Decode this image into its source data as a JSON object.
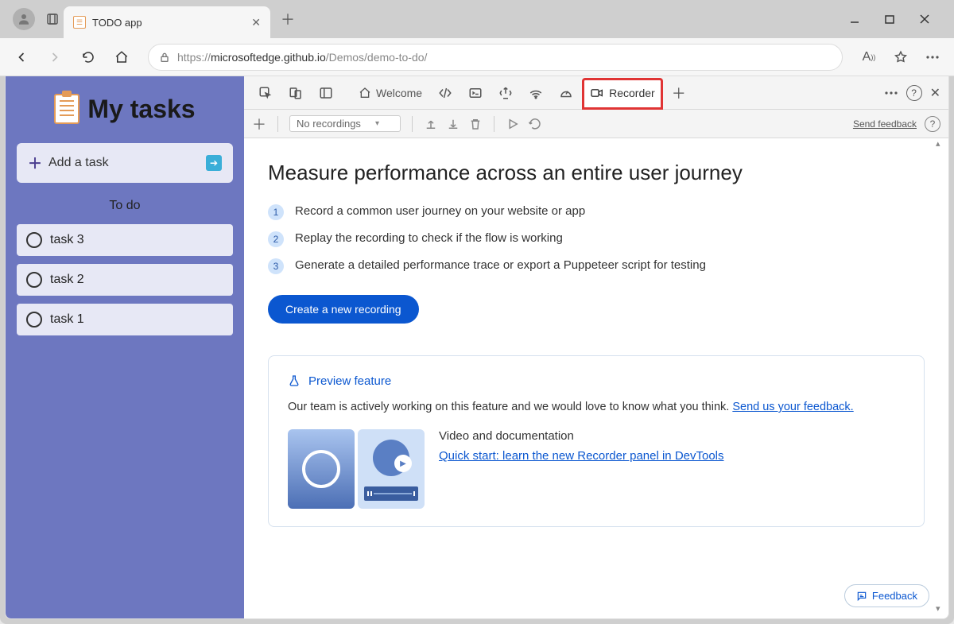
{
  "browser": {
    "tab_title": "TODO app",
    "url_host": "microsoftedge.github.io",
    "url_prefix": "https://",
    "url_path": "/Demos/demo-to-do/"
  },
  "app": {
    "title": "My tasks",
    "add_task_label": "Add a task",
    "section_label": "To do",
    "tasks": [
      "task 3",
      "task 2",
      "task 1"
    ]
  },
  "devtools": {
    "tabs": {
      "welcome": "Welcome",
      "recorder": "Recorder"
    },
    "toolbar": {
      "dropdown": "No recordings",
      "feedback_link": "Send feedback"
    },
    "main": {
      "heading": "Measure performance across an entire user journey",
      "steps": [
        "Record a common user journey on your website or app",
        "Replay the recording to check if the flow is working",
        "Generate a detailed performance trace or export a Puppeteer script for testing"
      ],
      "cta": "Create a new recording"
    },
    "preview": {
      "title": "Preview feature",
      "text_before": "Our team is actively working on this feature and we would love to know what you think. ",
      "link": "Send us your feedback.",
      "media_title": "Video and documentation",
      "media_link": "Quick start: learn the new Recorder panel in DevTools"
    },
    "feedback_button": "Feedback"
  }
}
